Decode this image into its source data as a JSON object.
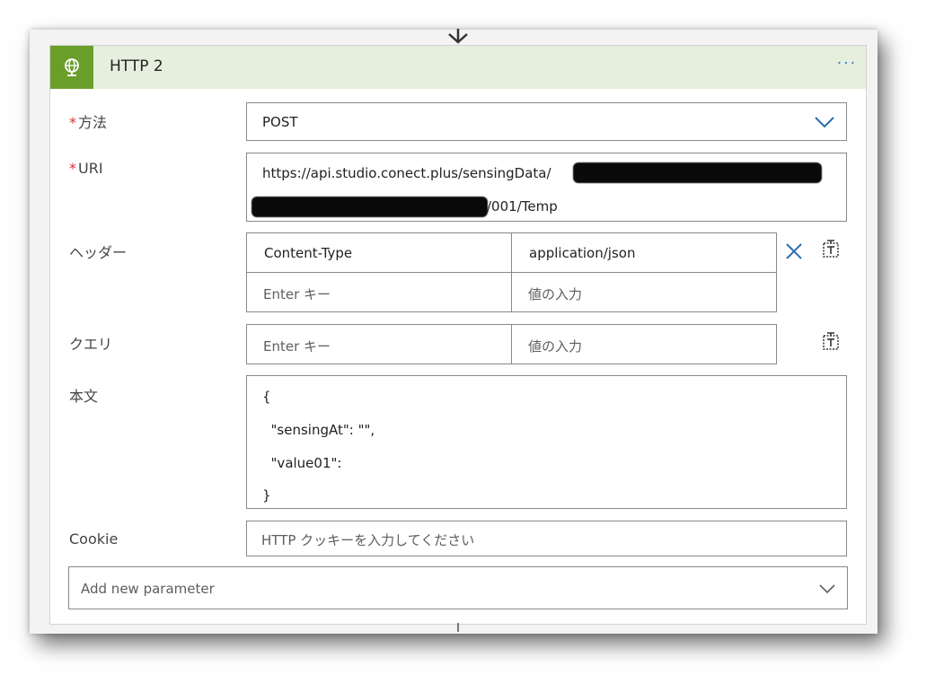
{
  "card": {
    "title": "HTTP 2",
    "more_label": "···",
    "header_icon": "globe-icon"
  },
  "method": {
    "label": "方法",
    "required_mark": "*",
    "value": "POST"
  },
  "uri": {
    "label": "URI",
    "required_mark": "*",
    "line1": "https://api.studio.conect.plus/sensingData/",
    "line2_suffix": "/001/Temp"
  },
  "headers": {
    "label": "ヘッダー",
    "rows": [
      {
        "key": "Content-Type",
        "value": "application/json"
      },
      {
        "key_placeholder": "Enter キー",
        "value_placeholder": "値の入力"
      }
    ]
  },
  "query": {
    "label": "クエリ",
    "key_placeholder": "Enter キー",
    "value_placeholder": "値の入力"
  },
  "body": {
    "label": "本文",
    "lines": [
      "{",
      "  \"sensingAt\": \"\",",
      "  \"value01\":",
      "}"
    ]
  },
  "cookie": {
    "label": "Cookie",
    "placeholder": "HTTP クッキーを入力してください"
  },
  "add_parameter": {
    "placeholder": "Add new parameter"
  },
  "colors": {
    "accent": "#3a7bc8",
    "header_bg": "#e6efdd",
    "icon_bg": "#6a9e2b",
    "required": "#d13438"
  }
}
